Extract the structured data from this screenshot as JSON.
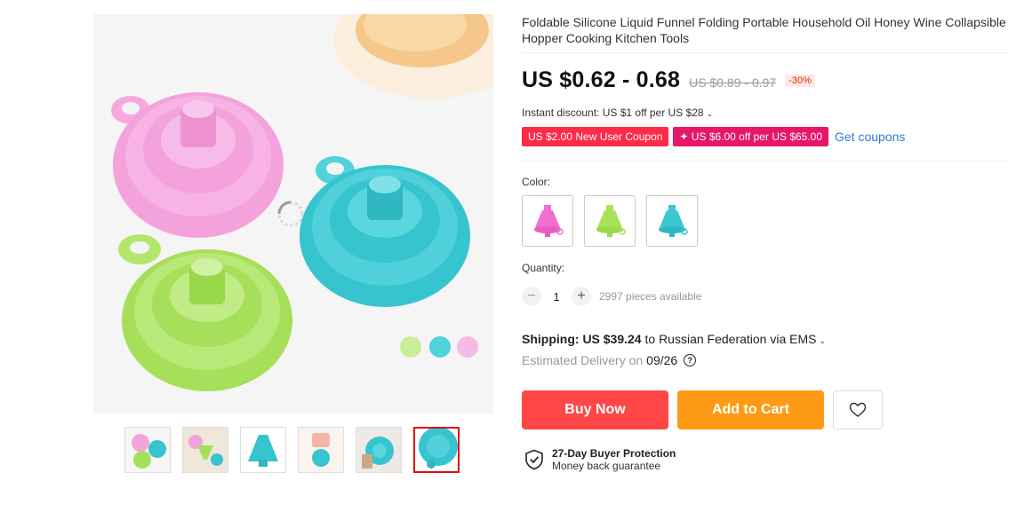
{
  "product": {
    "title": "Foldable Silicone Liquid Funnel Folding Portable Household Oil Honey Wine Collapsible Hopper Cooking Kitchen Tools",
    "price": "US $0.62 - 0.68",
    "old_price": "US $0.89 - 0.97",
    "discount": "-30%",
    "instant_discount": "Instant discount: US $1 off per US $28"
  },
  "coupons": {
    "new_user": "US $2.00 New User Coupon",
    "store": "✦ US $6.00 off per US $65.00",
    "get_label": "Get coupons"
  },
  "color": {
    "label": "Color:",
    "options": [
      {
        "name": "pink",
        "color": "#f06fd0"
      },
      {
        "name": "green",
        "color": "#a8e256"
      },
      {
        "name": "blue",
        "color": "#38c9d4"
      }
    ]
  },
  "quantity": {
    "label": "Quantity:",
    "minus": "−",
    "value": "1",
    "plus": "+",
    "available": "2997 pieces available"
  },
  "shipping": {
    "label": "Shipping:",
    "cost": "US $39.24",
    "destination": "to Russian Federation via EMS",
    "delivery_label": "Estimated Delivery on",
    "delivery_date": "09/26"
  },
  "actions": {
    "buy_now": "Buy Now",
    "add_to_cart": "Add to Cart"
  },
  "protection": {
    "title": "27-Day Buyer Protection",
    "subtitle": "Money back guarantee"
  },
  "colors": {
    "buy": "#ff4747",
    "cart": "#ff9a16",
    "coupon": "#ff2b46",
    "link": "#2e7bd6"
  },
  "icons": [
    "chevron-down-icon",
    "help-icon",
    "heart-icon",
    "shield-check-icon",
    "loading-spinner-icon"
  ]
}
